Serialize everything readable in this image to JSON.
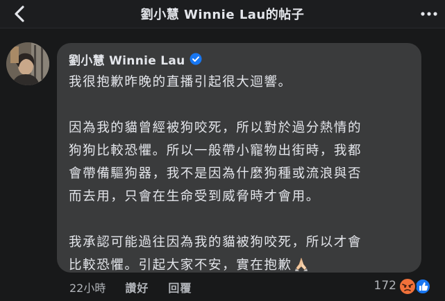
{
  "header": {
    "title": "劉小慧 Winnie Lau的帖子",
    "back_icon": "chevron-left-icon",
    "more_icon": "more-horizontal-icon"
  },
  "comment": {
    "author": "劉小慧 Winnie Lau",
    "verified_icon": "verified-badge-icon",
    "paragraphs": [
      [
        "我很抱歉昨晚的直播引起很大迴響。"
      ],
      [
        "因為我的貓曾經被狗咬死，所以對於過分熱情的",
        "狗狗比較恐懼。所以一般帶小寵物出街時，我都",
        "會帶備驅狗器，我不是因為什麼狗種或流浪與否",
        "而去用，只會在生命受到威脅時才會用。"
      ],
      [
        "我承認可能過往因為我的貓被狗咬死，所以才會",
        "比較恐懼。引起大家不安，實在抱歉"
      ]
    ],
    "emoji_icon": "folded-hands-icon",
    "time": "22小時",
    "like_label": "讚好",
    "reply_label": "回覆",
    "reaction_count": "172",
    "reaction_icons": [
      "angry-reaction-icon",
      "like-reaction-icon"
    ]
  },
  "colors": {
    "background": "#18191a",
    "bubble": "#3a3b3c",
    "verified": "#1877f2",
    "angry": "#f0713a"
  }
}
